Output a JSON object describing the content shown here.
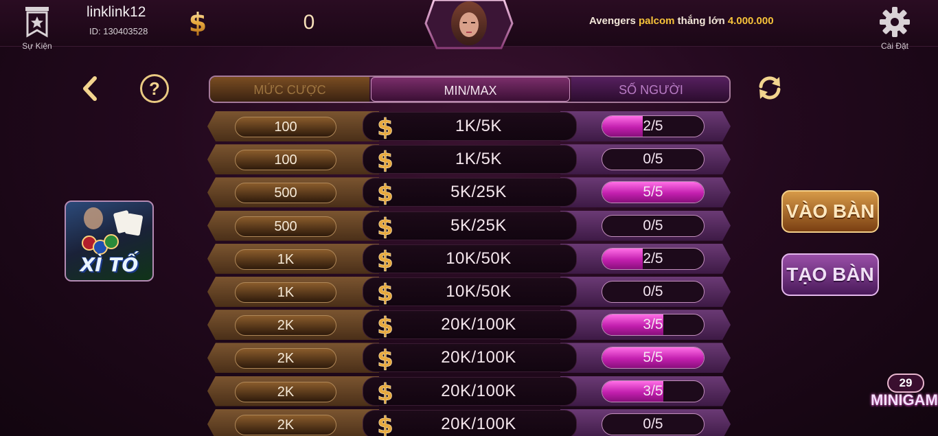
{
  "topbar": {
    "event_label": "Sự Kiện",
    "username": "linklink12",
    "user_id": "ID: 130403528",
    "balance": "0",
    "news": {
      "player": "Avengers",
      "game": "palcom",
      "verb": "thắng lớn",
      "amount": "4.000.000"
    },
    "settings_label": "Cài Đặt"
  },
  "header": {
    "col1": "MỨC CƯỢC",
    "col2": "MIN/MAX",
    "col3": "SỐ NGƯỜI"
  },
  "colors": {
    "gold": "#f2d48e",
    "pink_fill": "#e04cc8",
    "brown": "#7b5530",
    "purple": "#6b3a75"
  },
  "rows": [
    {
      "bet": "100",
      "minmax": "1K/5K",
      "players": "2/5",
      "fill": 0.4
    },
    {
      "bet": "100",
      "minmax": "1K/5K",
      "players": "0/5",
      "fill": 0
    },
    {
      "bet": "500",
      "minmax": "5K/25K",
      "players": "5/5",
      "fill": 1
    },
    {
      "bet": "500",
      "minmax": "5K/25K",
      "players": "0/5",
      "fill": 0
    },
    {
      "bet": "1K",
      "minmax": "10K/50K",
      "players": "2/5",
      "fill": 0.4
    },
    {
      "bet": "1K",
      "minmax": "10K/50K",
      "players": "0/5",
      "fill": 0
    },
    {
      "bet": "2K",
      "minmax": "20K/100K",
      "players": "3/5",
      "fill": 0.6
    },
    {
      "bet": "2K",
      "minmax": "20K/100K",
      "players": "5/5",
      "fill": 1
    },
    {
      "bet": "2K",
      "minmax": "20K/100K",
      "players": "3/5",
      "fill": 0.6
    },
    {
      "bet": "2K",
      "minmax": "20K/100K",
      "players": "0/5",
      "fill": 0
    }
  ],
  "game": {
    "title": "XÌ TỐ"
  },
  "buttons": {
    "join": "VÀO BÀN",
    "create": "TẠO BÀN"
  },
  "help_symbol": "?",
  "minigame": {
    "count": "29",
    "label": "MINIGAME"
  },
  "icons": [
    "star-flag-icon",
    "dollar-coin-icon",
    "gear-icon",
    "back-arrow-icon",
    "help-icon",
    "refresh-icon"
  ]
}
